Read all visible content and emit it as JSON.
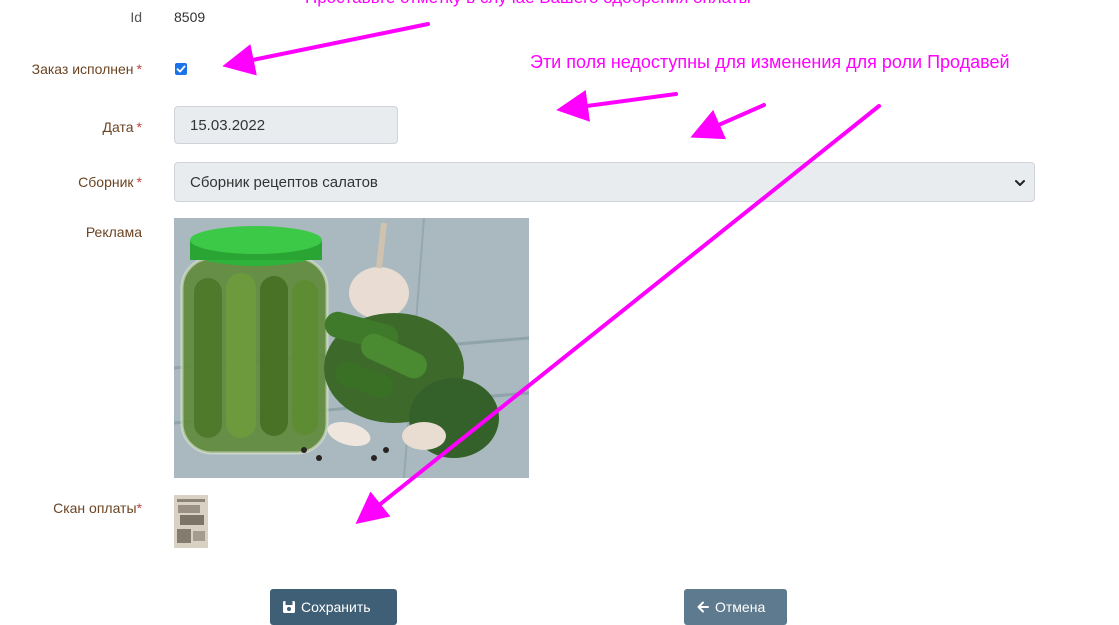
{
  "annotations": {
    "top_note": "Проставьте отметку в случае Вашего одобрения оплаты",
    "fields_note": "Эти поля недоступны для изменения для роли Продавей",
    "color": "#ff00ff"
  },
  "form": {
    "id": {
      "label": "Id",
      "value": "8509"
    },
    "order_done": {
      "label": "Заказ исполнен",
      "required_mark": "*",
      "checked": true
    },
    "date": {
      "label": "Дата",
      "required_mark": "*",
      "value": "15.03.2022"
    },
    "collection": {
      "label": "Сборник",
      "required_mark": "*",
      "selected": "Сборник рецептов салатов"
    },
    "advert": {
      "label": "Реклама",
      "image": "pickled-cucumbers-jar-photo"
    },
    "payment_scan": {
      "label": "Скан оплаты",
      "required_mark": "*",
      "image": "payment-scan-thumbnail"
    }
  },
  "buttons": {
    "save": {
      "label": "Сохранить",
      "icon": "floppy-disk-icon"
    },
    "cancel": {
      "label": "Отмена",
      "icon": "arrow-left-icon"
    }
  },
  "colors": {
    "label_text": "#6b4423",
    "button_primary": "#3e5f76",
    "button_secondary": "#5d7a8e",
    "input_disabled_bg": "#e9ecef",
    "checkbox": "#1a73e8"
  }
}
